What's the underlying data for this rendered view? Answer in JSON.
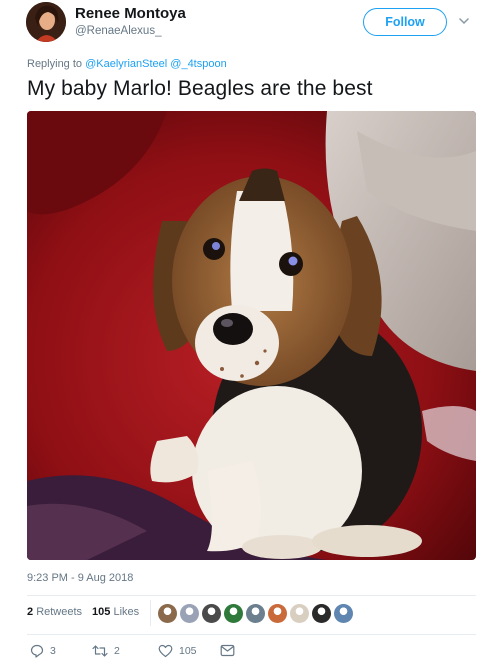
{
  "author": {
    "name": "Renee Montoya",
    "handle": "@RenaeAlexus_",
    "follow_label": "Follow"
  },
  "reply": {
    "prefix": "Replying to",
    "mentions": [
      "@KaelyrianSteel",
      "@_4tspoon"
    ]
  },
  "tweet": {
    "text": "My baby Marlo! Beagles are the best",
    "timestamp": "9:23 PM - 9 Aug 2018"
  },
  "stats": {
    "retweets_count": "2",
    "retweets_label": "Retweets",
    "likes_count": "105",
    "likes_label": "Likes"
  },
  "likers": [
    {
      "color": "#8a6a4a"
    },
    {
      "color": "#9aa3b5"
    },
    {
      "color": "#4a4a4a"
    },
    {
      "color": "#2f7a3a"
    },
    {
      "color": "#6b7f8f"
    },
    {
      "color": "#c96a3a"
    },
    {
      "color": "#d9cfc0"
    },
    {
      "color": "#2a2a2a"
    },
    {
      "color": "#5e86b0"
    }
  ],
  "actions": {
    "replies": "3",
    "retweets": "2",
    "likes": "105"
  },
  "colors": {
    "accent": "#1da1f2",
    "muted": "#657786",
    "text": "#14171a"
  }
}
